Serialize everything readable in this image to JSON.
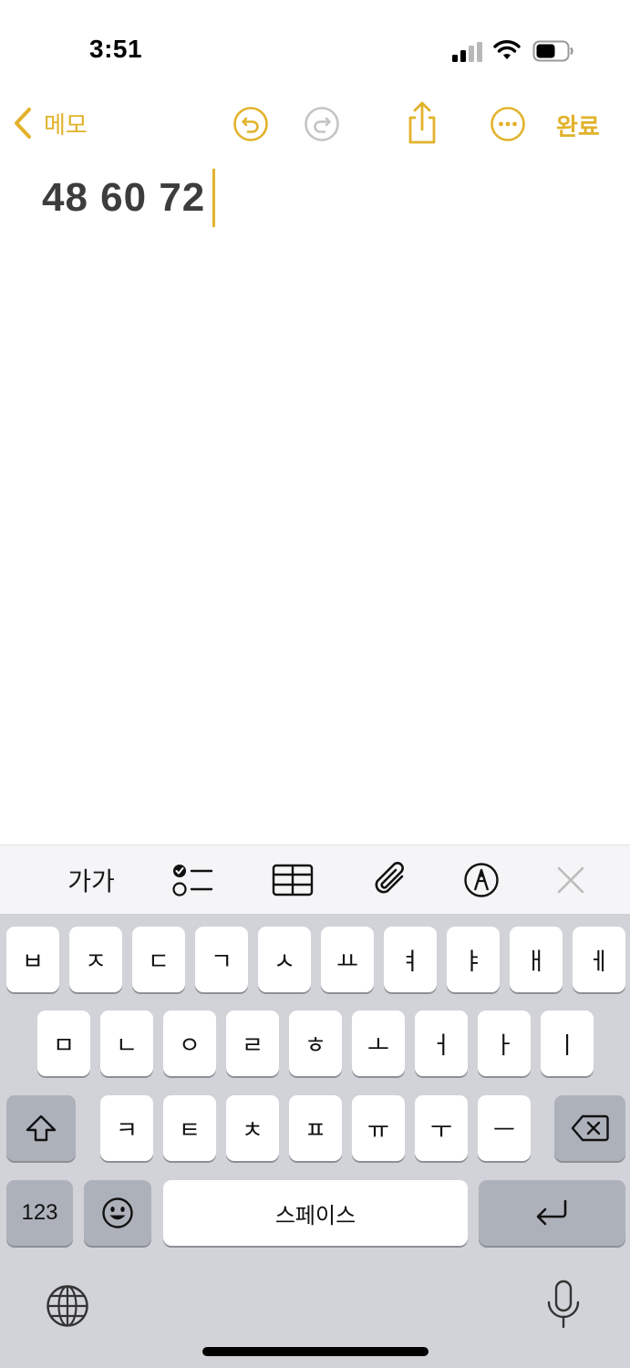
{
  "status_bar": {
    "time": "3:51",
    "icons": [
      "cellular-signal-icon",
      "wifi-icon",
      "battery-icon"
    ]
  },
  "nav": {
    "back_label": "메모",
    "done_label": "완료",
    "accent_color": "#e2b22b",
    "icons": [
      "chevron-left-icon",
      "undo-icon",
      "redo-icon",
      "share-icon",
      "more-icon"
    ]
  },
  "note": {
    "text": "48 60 72"
  },
  "format_toolbar": {
    "text_style_label": "가가",
    "icons": [
      "checklist-icon",
      "table-icon",
      "paperclip-icon",
      "markup-pen-icon",
      "close-icon"
    ]
  },
  "keyboard": {
    "row1": [
      "ㅂ",
      "ㅈ",
      "ㄷ",
      "ㄱ",
      "ㅅ",
      "ㅛ",
      "ㅕ",
      "ㅑ",
      "ㅐ",
      "ㅔ"
    ],
    "row2": [
      "ㅁ",
      "ㄴ",
      "ㅇ",
      "ㄹ",
      "ㅎ",
      "ㅗ",
      "ㅓ",
      "ㅏ",
      "ㅣ"
    ],
    "row3": [
      "ㅋ",
      "ㅌ",
      "ㅊ",
      "ㅍ",
      "ㅠ",
      "ㅜ",
      "ㅡ"
    ],
    "numbers_label": "123",
    "space_label": "스페이스",
    "icons": [
      "shift-icon",
      "backspace-icon",
      "emoji-icon",
      "return-icon",
      "globe-icon",
      "microphone-icon"
    ]
  }
}
